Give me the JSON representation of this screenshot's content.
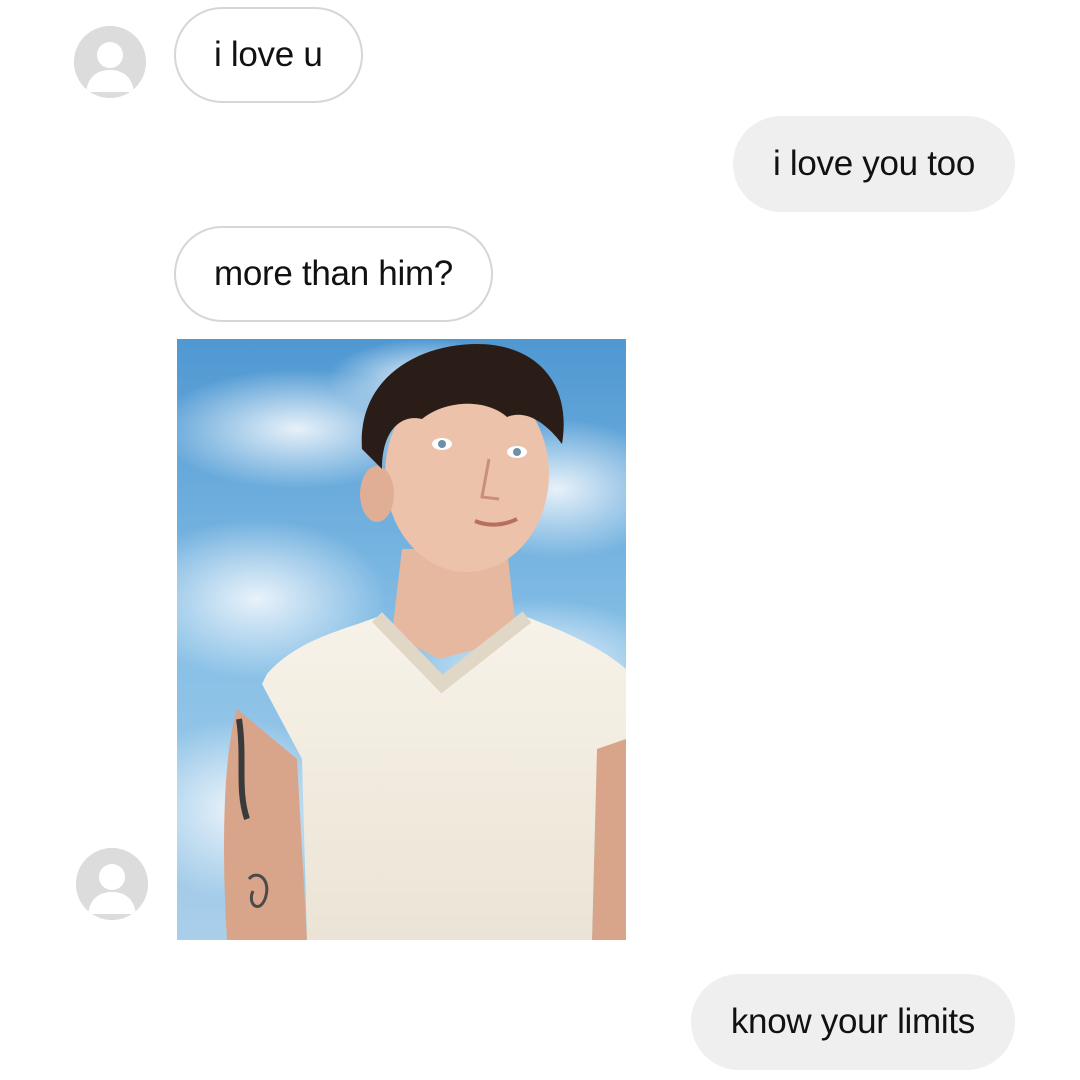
{
  "messages": [
    {
      "id": "m1",
      "direction": "received",
      "text": "i love u"
    },
    {
      "id": "m2",
      "direction": "sent",
      "text": "i love you too"
    },
    {
      "id": "m3",
      "direction": "received",
      "text": "more than him?"
    },
    {
      "id": "m4",
      "direction": "received",
      "type": "photo",
      "photo_subject": "man in white sleeveless knit vest against blue cloudy sky"
    },
    {
      "id": "m5",
      "direction": "sent",
      "text": "know your limits"
    }
  ],
  "avatar": {
    "icon": "default-profile-icon"
  },
  "colors": {
    "background": "#ffffff",
    "sent_bubble": "#efefef",
    "received_border": "#d6d6d6",
    "avatar_placeholder": "#dcdcdc",
    "sky": "#5fa3d6"
  }
}
